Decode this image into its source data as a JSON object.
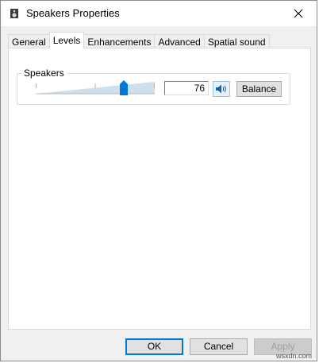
{
  "window": {
    "title": "Speakers Properties"
  },
  "tabs": [
    {
      "label": "General"
    },
    {
      "label": "Levels"
    },
    {
      "label": "Enhancements"
    },
    {
      "label": "Advanced"
    },
    {
      "label": "Spatial sound"
    }
  ],
  "active_tab": "Levels",
  "levels": {
    "group_label": "Speakers",
    "level_value": "76",
    "slider_fraction": 0.76,
    "balance_label": "Balance"
  },
  "footer": {
    "ok_label": "OK",
    "cancel_label": "Cancel",
    "apply_label": "Apply"
  },
  "watermark": "wsxdn.com",
  "colors": {
    "accent": "#0078d7",
    "slider_track": "#cfe0ec"
  }
}
